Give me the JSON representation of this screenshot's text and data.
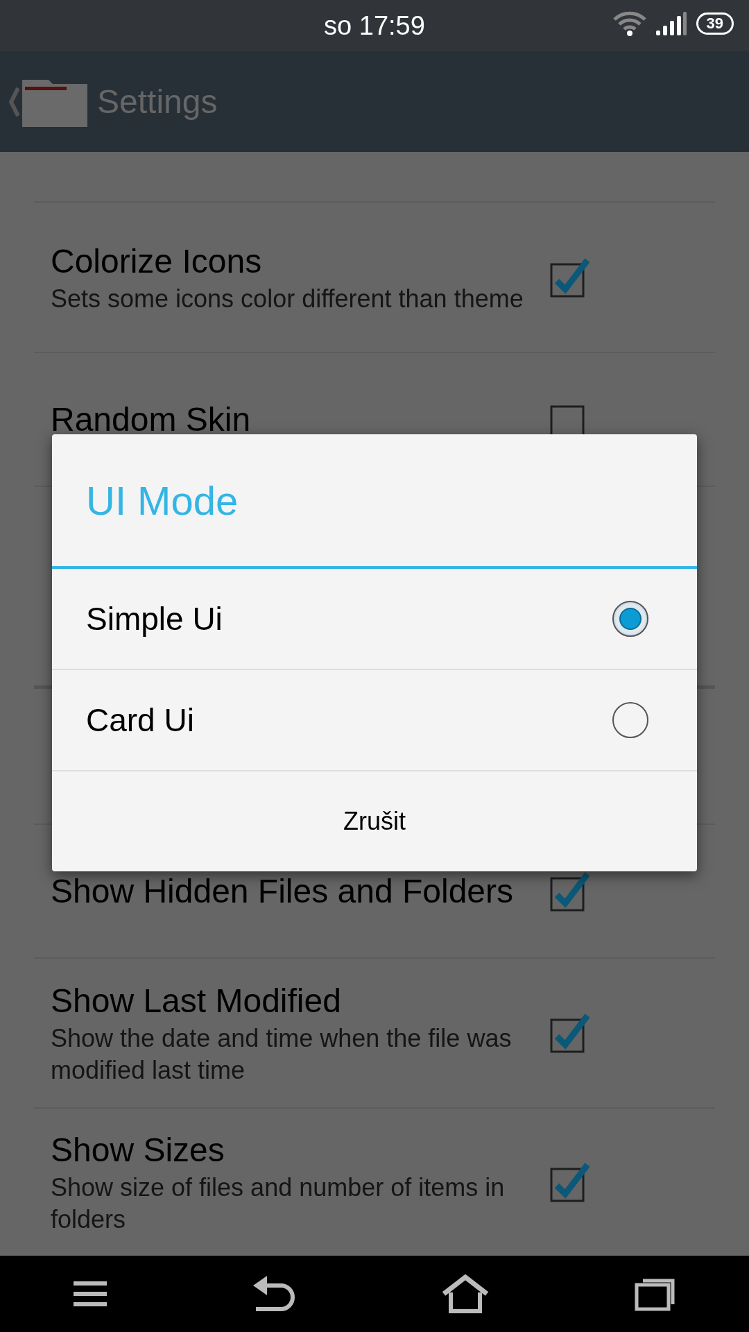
{
  "status_bar": {
    "time": "so 17:59",
    "battery": "39"
  },
  "header": {
    "title": "Settings"
  },
  "settings": [
    {
      "kind": "row",
      "title": "Colorize Icons",
      "subtitle": "Sets some icons color different than theme",
      "checked": true
    },
    {
      "kind": "row",
      "title": "Random Skin",
      "checked": false
    },
    {
      "kind": "covered"
    },
    {
      "kind": "covered"
    },
    {
      "kind": "row",
      "title": "Show Hidden Files and Folders",
      "checked": true
    },
    {
      "kind": "row",
      "title": "Show Last Modified",
      "subtitle": "Show the date and time when the file was modified last time",
      "checked": true
    },
    {
      "kind": "row",
      "title": "Show Sizes",
      "subtitle": "Show size of files and number of items in folders",
      "checked": true
    }
  ],
  "dialog": {
    "title": "UI Mode",
    "options": [
      {
        "label": "Simple Ui",
        "selected": true
      },
      {
        "label": "Card Ui",
        "selected": false
      }
    ],
    "button": "Zrušit"
  }
}
